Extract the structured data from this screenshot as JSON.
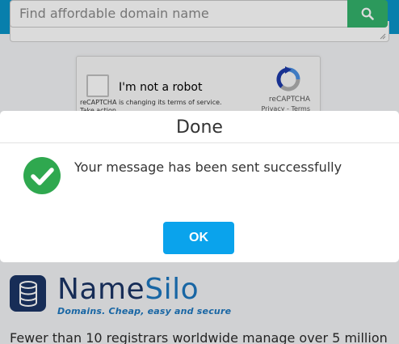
{
  "search": {
    "placeholder": "Find affordable domain name",
    "button_icon": "search-icon"
  },
  "recaptcha": {
    "label": "I'm not a robot",
    "brand": "reCAPTCHA",
    "links": "Privacy - Terms",
    "notice_line1": "reCAPTCHA is changing its terms of service.",
    "notice_line2": "Take action."
  },
  "logo": {
    "name_part1": "Name",
    "name_part2": "Silo",
    "tagline": "Domains. Cheap, easy and secure"
  },
  "intro": {
    "text": "Fewer than 10 registrars worldwide manage over 5 million"
  },
  "modal": {
    "title": "Done",
    "message": "Your message has been sent successfully",
    "ok_label": "OK",
    "icon": "check-circle-icon"
  },
  "colors": {
    "header_blue": "#0a94c9",
    "search_green": "#34b36c",
    "success_green": "#2fa84f",
    "ok_button": "#0aa3ec",
    "brand_dark": "#1b3566",
    "brand_light": "#1d77bf"
  }
}
